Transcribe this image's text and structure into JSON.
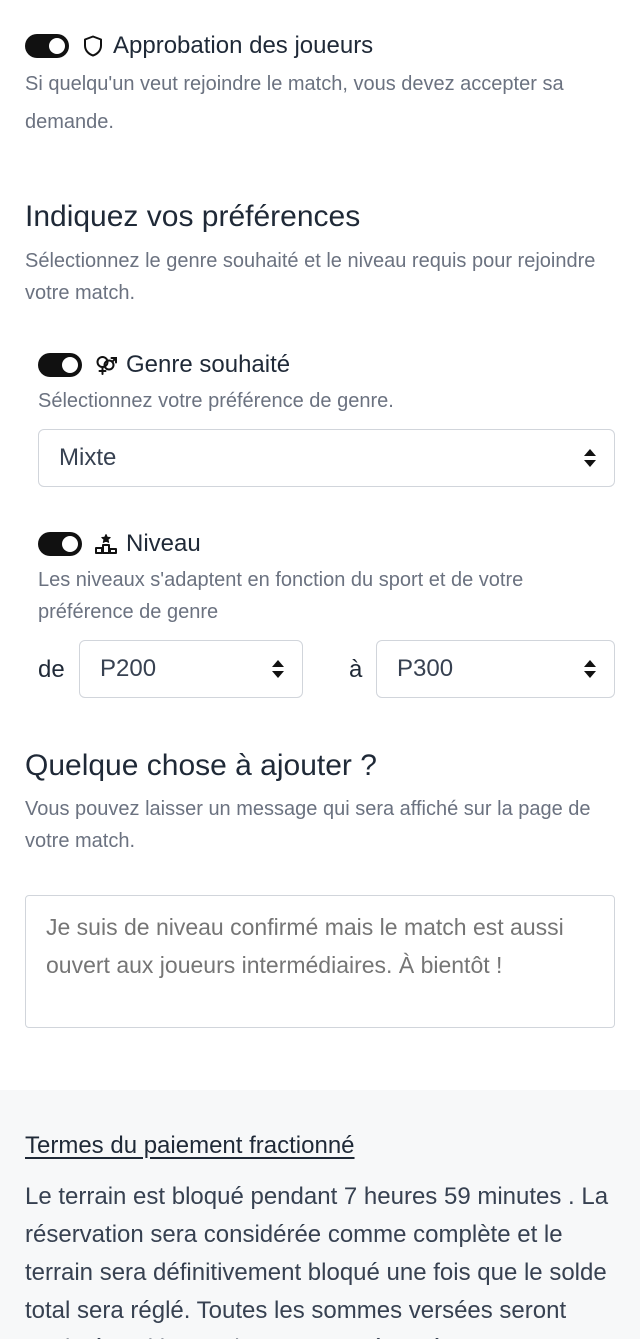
{
  "approval": {
    "label": "Approbation des joueurs",
    "description": "Si quelqu'un veut rejoindre le match, vous devez accepter sa demande.",
    "enabled": true
  },
  "preferences": {
    "title": "Indiquez vos préférences",
    "description": "Sélectionnez le genre souhaité et le niveau requis pour rejoindre votre match.",
    "gender": {
      "label": "Genre souhaité",
      "description": "Sélectionnez votre préférence de genre.",
      "selected": "Mixte",
      "enabled": true
    },
    "level": {
      "label": "Niveau",
      "description": "Les niveaux s'adaptent en fonction du sport et de votre préférence de genre",
      "from_word": "de",
      "to_word": "à",
      "from_value": "P200",
      "to_value": "P300",
      "enabled": true
    }
  },
  "message": {
    "title": "Quelque chose à ajouter ?",
    "description": "Vous pouvez laisser un message qui sera affiché sur la page de votre match.",
    "placeholder": "Je suis de niveau confirmé mais le match est aussi ouvert aux joueurs intermédiaires. À bientôt !"
  },
  "payment_terms": {
    "link": "Termes du paiement fractionné",
    "text": "Le terrain est bloqué pendant 7 heures 59 minutes . La réservation sera considérée comme complète et le terrain sera définitivement bloqué une fois que le solde total sera réglé. Toutes les sommes versées seront restituées si le terrain n'est pas réservé"
  },
  "icons": {
    "approval": "shield-icon",
    "gender": "gender-icon",
    "level": "podium-icon"
  }
}
